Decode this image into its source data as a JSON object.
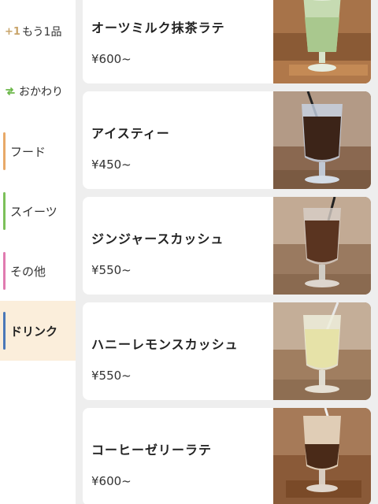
{
  "sidebar": {
    "one_more": {
      "badge": "+1",
      "label": "もう1品"
    },
    "refill": {
      "label": "おかわり"
    },
    "categories": [
      {
        "label": "フード",
        "color": "#e8a968"
      },
      {
        "label": "スイーツ",
        "color": "#7cc05a"
      },
      {
        "label": "その他",
        "color": "#e07bb0"
      },
      {
        "label": "ドリンク",
        "color": "#4a78b8",
        "active": true
      }
    ]
  },
  "menu": {
    "items": [
      {
        "name": "オーツミルク抹茶ラテ",
        "price": "¥600~",
        "photo": "matcha-latte-photo"
      },
      {
        "name": "アイスティー",
        "price": "¥450~",
        "photo": "iced-tea-photo"
      },
      {
        "name": "ジンジャースカッシュ",
        "price": "¥550~",
        "photo": "ginger-squash-photo"
      },
      {
        "name": "ハニーレモンスカッシュ",
        "price": "¥550~",
        "photo": "honey-lemon-photo"
      },
      {
        "name": "コーヒーゼリーラテ",
        "price": "¥600~",
        "photo": "coffee-jelly-latte-photo"
      }
    ]
  },
  "colors": {
    "accent_active_bg": "#fbeedb",
    "refill_icon": "#6cb84a",
    "plus_badge": "#c8a46a"
  }
}
